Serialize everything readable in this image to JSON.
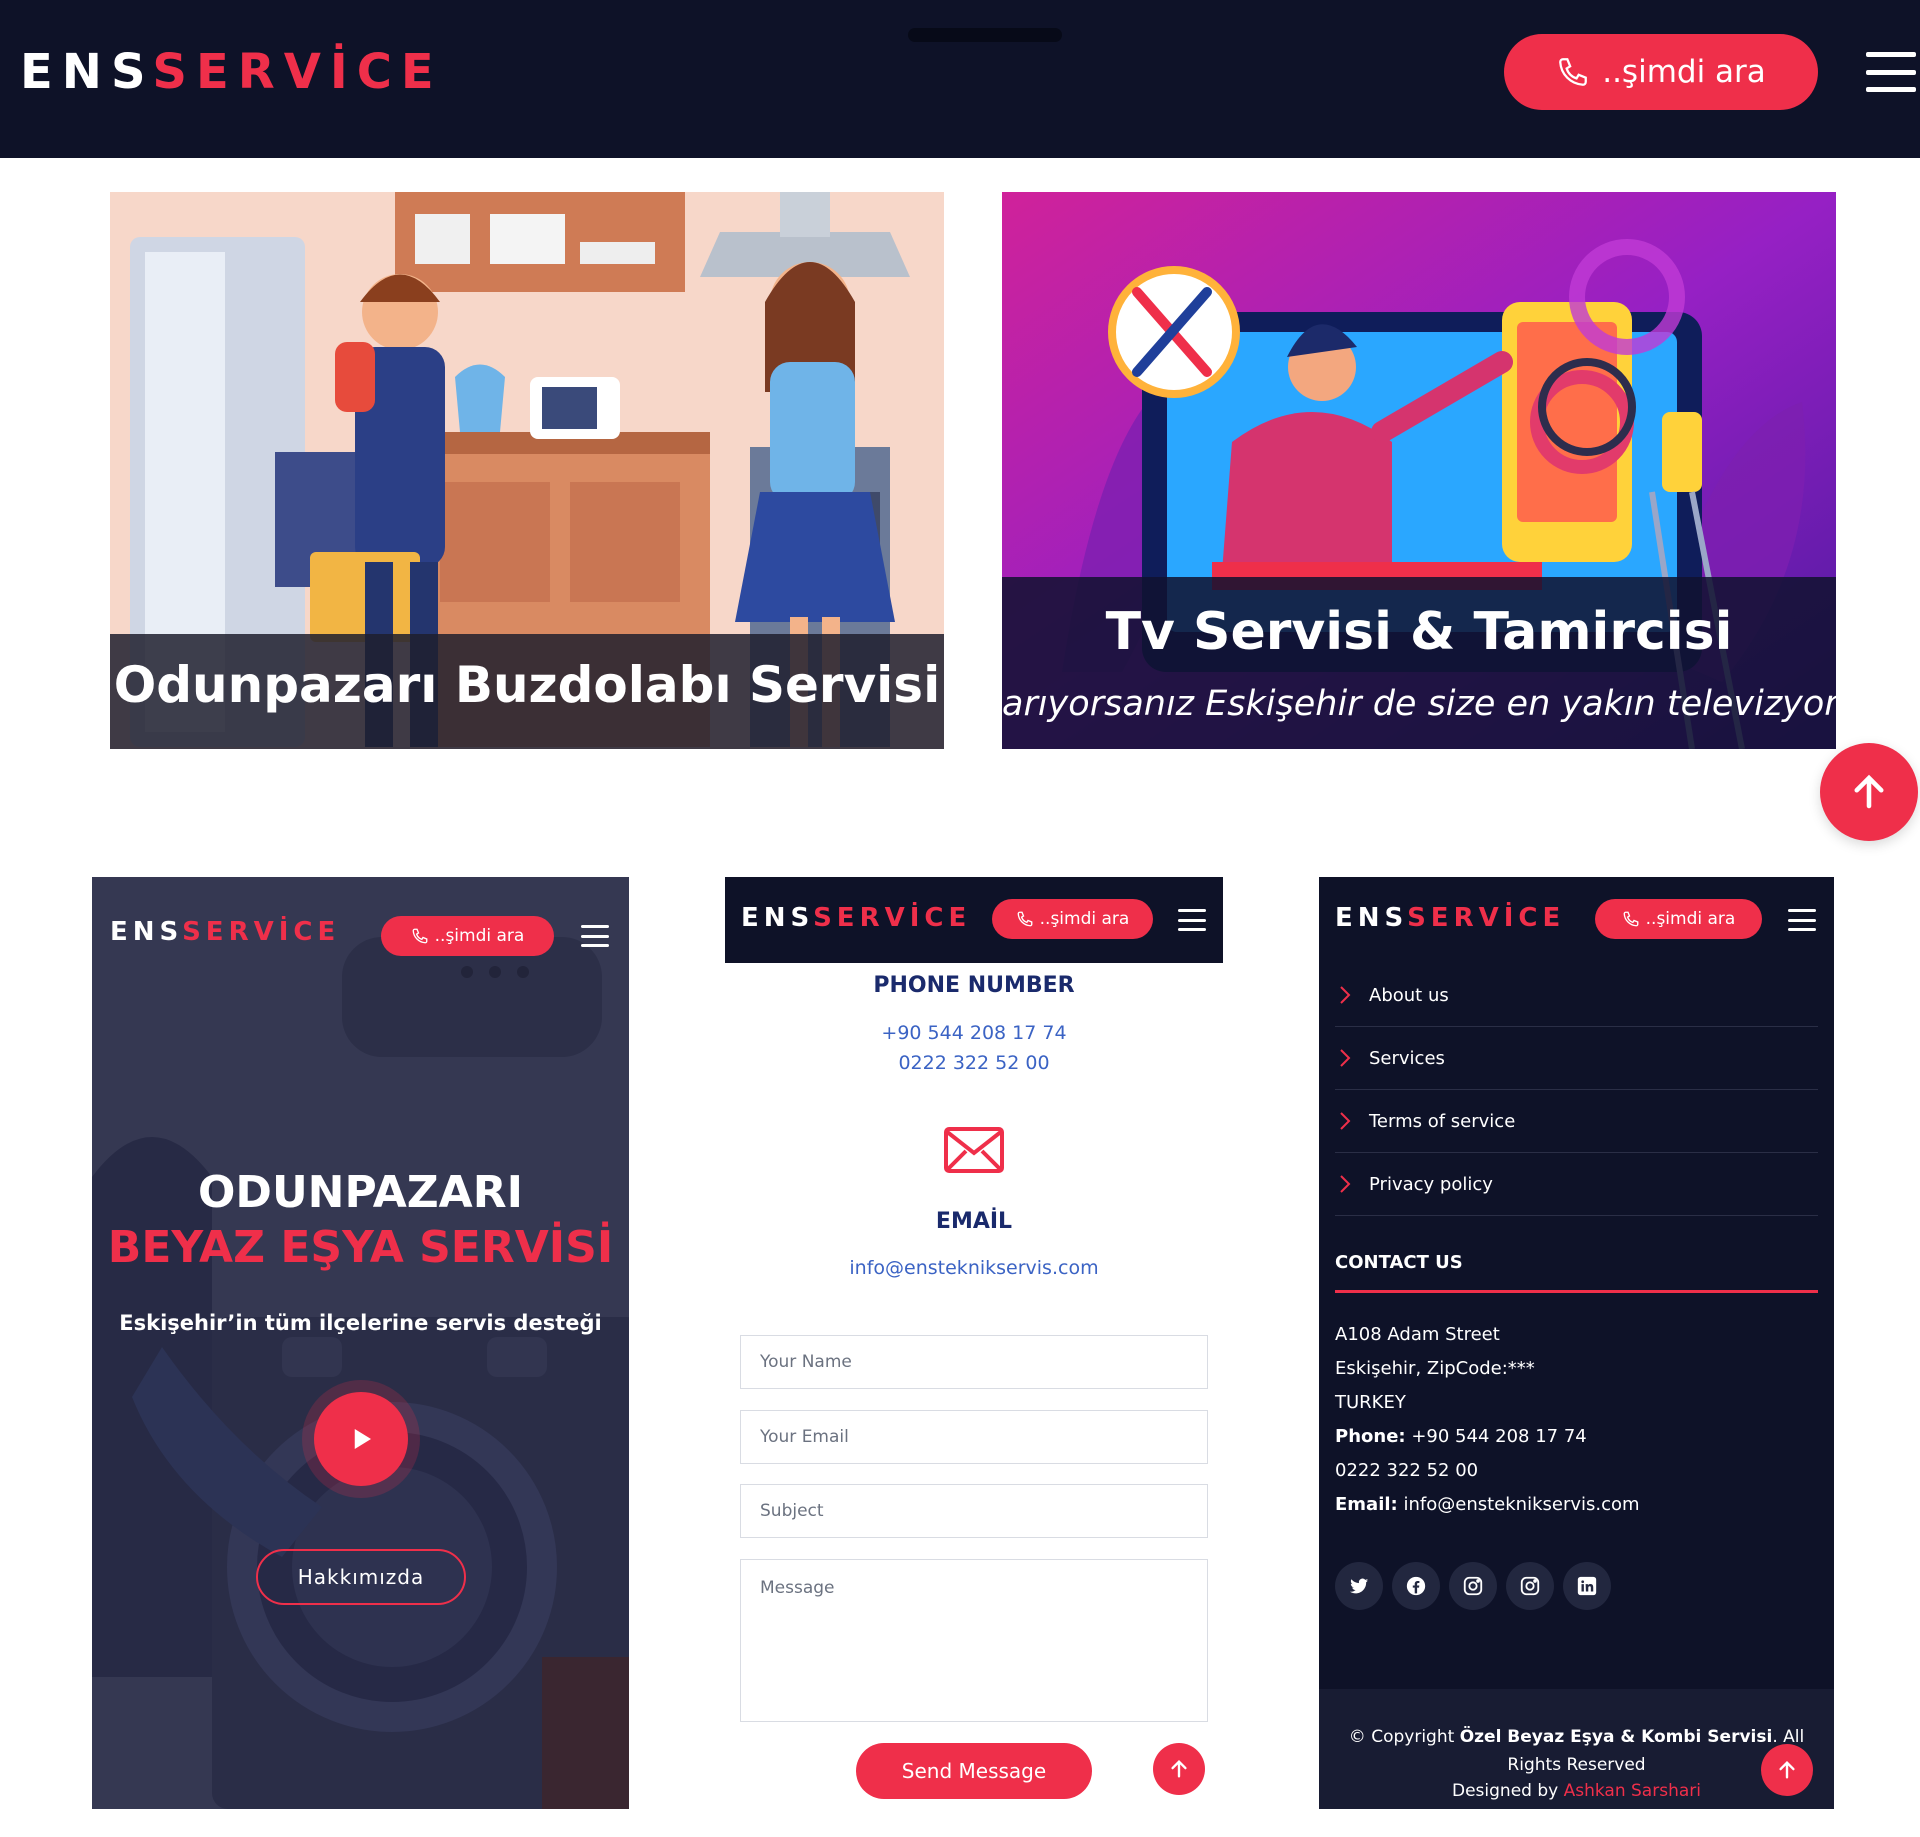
{
  "brand": {
    "part1": "ENS",
    "part2": "SERVİCE"
  },
  "header": {
    "call_label": "..şimdi ara"
  },
  "cards": [
    {
      "title": "Odunpazarı Buzdolabı Servisi"
    },
    {
      "title": "Tv Servisi & Tamircisi",
      "subtitle": "arıyorsanız Eskişehir de size en yakın televizyon"
    }
  ],
  "hero": {
    "title_line1": "ODUNPAZARI",
    "title_line2": "BEYAZ EŞYA SERVİSİ",
    "subtitle": "Eskişehir’in tüm ilçelerine servis desteği",
    "about_button": "Hakkımızda"
  },
  "contact": {
    "phone_heading": "PHONE NUMBER",
    "phone1": "+90 544 208 17 74",
    "phone2": "0222 322 52 00",
    "email_heading": "EMAİL",
    "email": "info@ensteknikservis.com"
  },
  "form": {
    "name_placeholder": "Your Name",
    "email_placeholder": "Your Email",
    "subject_placeholder": "Subject",
    "message_placeholder": "Message",
    "send_label": "Send Message"
  },
  "footer": {
    "menu": [
      "About us",
      "Services",
      "Terms of service",
      "Privacy policy"
    ],
    "contact_title": "CONTACT US",
    "address_line1": "A108 Adam Street",
    "address_line2": "Eskişehir, ZipCode:***",
    "address_line3": "TURKEY",
    "phone_label": "Phone:",
    "phone_value": "+90 544 208 17 74",
    "phone_value2": "0222 322 52 00",
    "email_label": "Email:",
    "email_value": "info@ensteknikservis.com",
    "social_icons": [
      "twitter-icon",
      "facebook-icon",
      "instagram-icon",
      "instagram-icon",
      "linkedin-icon"
    ],
    "copyright_prefix": "© Copyright",
    "copyright_company": "Özel Beyaz Eşya & Kombi Servisi",
    "copyright_suffix": ". All",
    "copyright_line2": "Rights Reserved",
    "designed_by_label": "Designed by",
    "designer": "Ashkan Sarshari"
  },
  "colors": {
    "accent": "#ef2f4a",
    "navy": "#0e1228",
    "link": "#3b63c4"
  }
}
